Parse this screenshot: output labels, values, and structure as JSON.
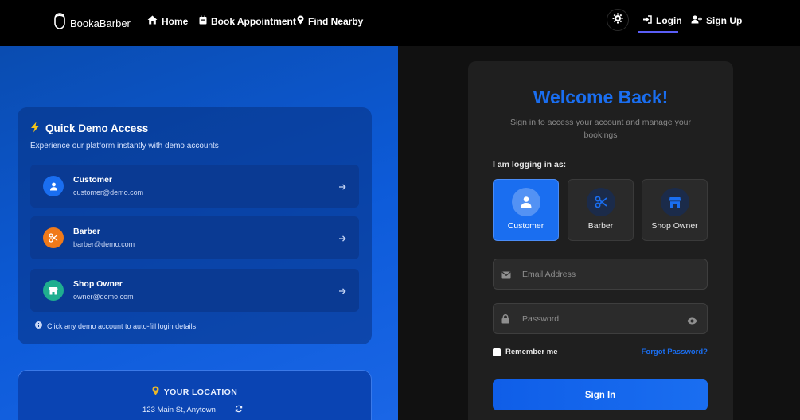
{
  "colors": {
    "accent": "#1a6ef0",
    "nav_bg": "#000000",
    "left_panel": "#0d5bd9",
    "customer_icon": "#1a6ef0",
    "barber_icon": "#f07a1a",
    "shop_owner_icon": "#1fae8f",
    "location_pin": "#e8b72a"
  },
  "navbar": {
    "brand": "BookaBarber",
    "links": [
      {
        "label": "Home",
        "icon": "home-icon"
      },
      {
        "label": "Book Appointment",
        "icon": "calendar-icon"
      },
      {
        "label": "Find Nearby",
        "icon": "map-pin-icon"
      }
    ],
    "theme_toggle_icon": "gear-icon",
    "login": "Login",
    "signup": "Sign Up"
  },
  "demo": {
    "title": "Quick Demo Access",
    "subtitle": "Experience our platform instantly with demo accounts",
    "accounts": [
      {
        "name": "Customer",
        "email": "customer@demo.com",
        "icon": "user-icon"
      },
      {
        "name": "Barber",
        "email": "barber@demo.com",
        "icon": "scissors-icon"
      },
      {
        "name": "Shop Owner",
        "email": "owner@demo.com",
        "icon": "store-icon"
      }
    ],
    "hint": "Click any demo account to auto-fill login details"
  },
  "location": {
    "title": "YOUR LOCATION",
    "address": "123 Main St, Anytown"
  },
  "login": {
    "title": "Welcome Back!",
    "subtitle": "Sign in to access your account and manage your bookings",
    "role_label": "I am logging in as:",
    "roles": [
      {
        "label": "Customer",
        "icon": "user-icon",
        "selected": true
      },
      {
        "label": "Barber",
        "icon": "scissors-icon",
        "selected": false
      },
      {
        "label": "Shop Owner",
        "icon": "store-icon",
        "selected": false
      }
    ],
    "email_placeholder": "Email Address",
    "email_value": "",
    "password_placeholder": "Password",
    "password_value": "",
    "remember_me": "Remember me",
    "forgot_password": "Forgot Password?",
    "submit": "Sign In"
  }
}
